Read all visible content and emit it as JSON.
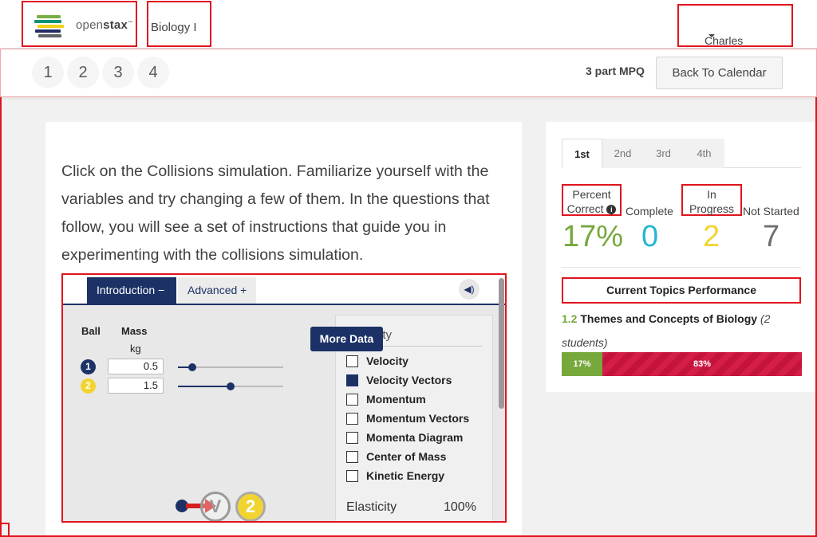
{
  "header": {
    "logo_text_light": "open",
    "logo_text_bold": "stax",
    "logo_tm": "™",
    "course_name": "Biology I",
    "user_name": "Charles Morris"
  },
  "subbar": {
    "steps": [
      "1",
      "2",
      "3",
      "4"
    ],
    "mpq_label": "3 part MPQ",
    "back_button": "Back To Calendar"
  },
  "question": {
    "text": "Click on the Collisions simulation. Familiarize yourself with the variables and try changing a few of them. In the questions that follow, you will see a set of instructions that guide you in experimenting with the collisions simulation."
  },
  "simulation": {
    "tab_intro": "Introduction −",
    "tab_advanced": "Advanced +",
    "col_ball": "Ball",
    "col_mass": "Mass",
    "unit_kg": "kg",
    "ball1_label": "1",
    "ball2_label": "2",
    "ball1_mass": "0.5",
    "ball2_mass": "1.5",
    "ball1_slider_fraction": 0.14,
    "ball2_slider_fraction": 0.5,
    "more_data": "More Data",
    "panel_title_partial": "ity",
    "checkboxes": [
      {
        "label": "Velocity",
        "checked": false
      },
      {
        "label": "Velocity Vectors",
        "checked": true
      },
      {
        "label": "Momentum",
        "checked": false
      },
      {
        "label": "Momentum Vectors",
        "checked": false
      },
      {
        "label": "Momenta Diagram",
        "checked": false
      },
      {
        "label": "Center of Mass",
        "checked": false
      },
      {
        "label": "Kinetic Energy",
        "checked": false
      }
    ],
    "elasticity_label": "Elasticity",
    "elasticity_value": "100%",
    "bottom_ball_v": "V",
    "bottom_ball_2": "2",
    "colors": {
      "navy": "#1c3166",
      "yellow": "#f2d431",
      "red": "#d42020"
    }
  },
  "performance": {
    "period_tabs": [
      "1st",
      "2nd",
      "3rd",
      "4th"
    ],
    "active_tab": "1st",
    "stats": {
      "percent_correct_label_1": "Percent",
      "percent_correct_label_2": "Correct",
      "complete_label": "Complete",
      "in_progress_label_1": "In",
      "in_progress_label_2": "Progress",
      "not_started_label": "Not Started",
      "percent_correct_value": "17%",
      "complete_value": "0",
      "in_progress_value": "2",
      "not_started_value": "7"
    },
    "colors": {
      "percent_correct": "#76a83c",
      "complete": "#27b5d2",
      "in_progress": "#f2d431",
      "not_started": "#6f6f6f",
      "bar_correct": "#76a83c",
      "bar_incorrect": "#d41d48"
    },
    "topics_title": "Current Topics Performance",
    "topic": {
      "number": "1.2",
      "name": "Themes and Concepts of Biology",
      "students": "(2 students)",
      "correct_pct_label": "17%",
      "incorrect_pct_label": "83%",
      "correct_fraction": 0.17,
      "incorrect_fraction": 0.83
    }
  }
}
